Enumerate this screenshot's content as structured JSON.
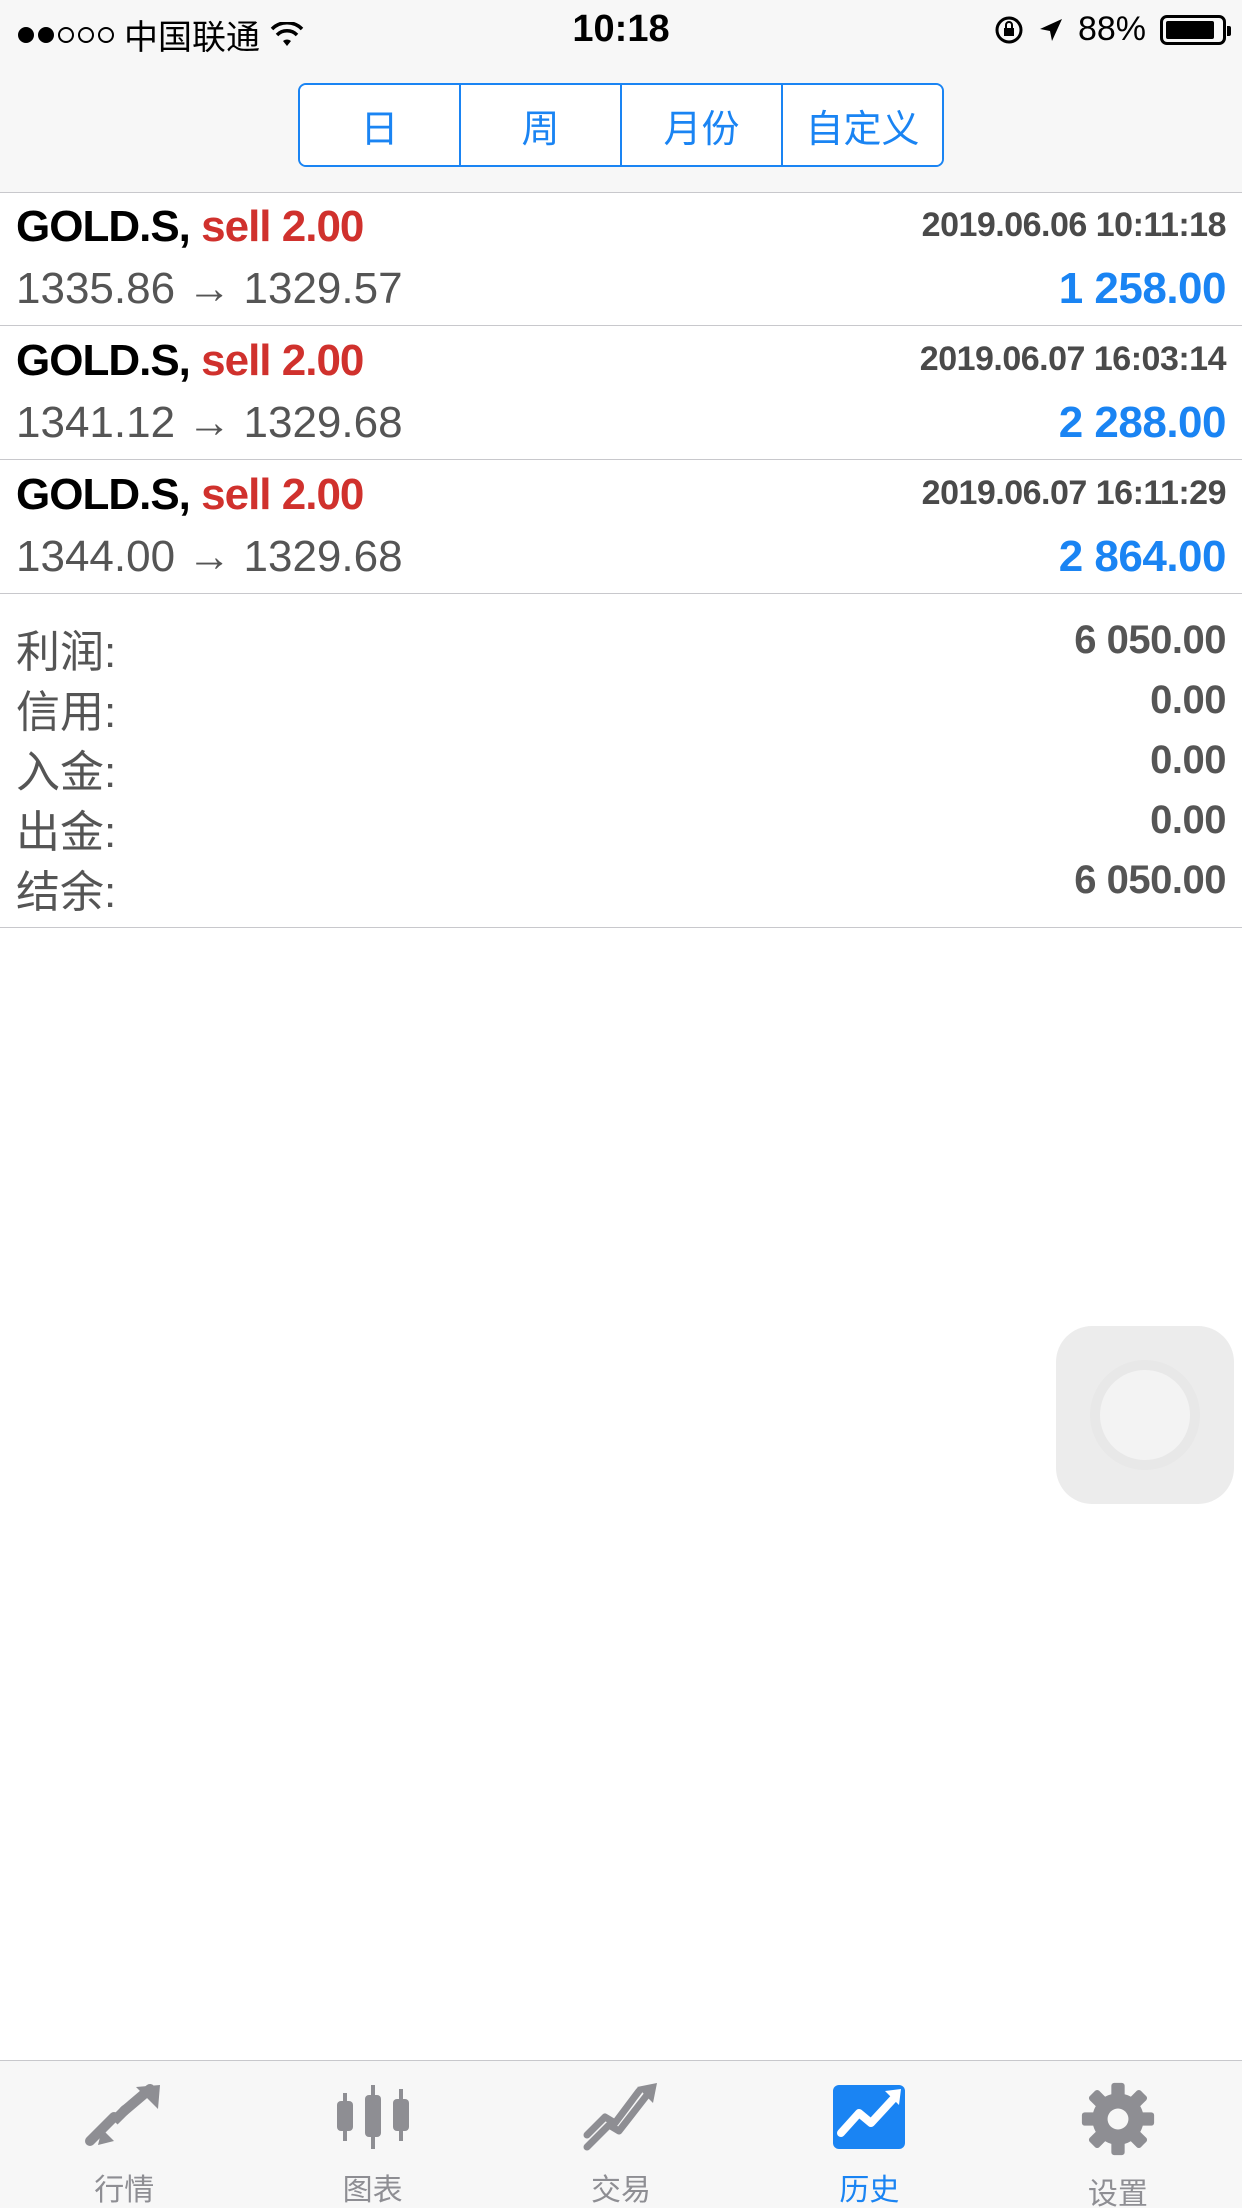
{
  "status_bar": {
    "carrier": "中国联通",
    "time": "10:18",
    "battery": "88%",
    "battery_level": 0.88
  },
  "period_tabs": [
    {
      "label": "日",
      "active": true
    },
    {
      "label": "周",
      "active": false
    },
    {
      "label": "月份",
      "active": false
    },
    {
      "label": "自定义",
      "active": false
    }
  ],
  "trades": [
    {
      "symbol": "GOLD.S,",
      "type": "sell 2.00",
      "time": "2019.06.06 10:11:18",
      "prices": "1335.86 → 1329.57",
      "profit": "1 258.00"
    },
    {
      "symbol": "GOLD.S,",
      "type": "sell 2.00",
      "time": "2019.06.07 16:03:14",
      "prices": "1341.12 → 1329.68",
      "profit": "2 288.00"
    },
    {
      "symbol": "GOLD.S,",
      "type": "sell 2.00",
      "time": "2019.06.07 16:11:29",
      "prices": "1344.00 → 1329.68",
      "profit": "2 864.00"
    }
  ],
  "summary": [
    {
      "label": "利润:",
      "value": "6 050.00"
    },
    {
      "label": "信用:",
      "value": "0.00"
    },
    {
      "label": "入金:",
      "value": "0.00"
    },
    {
      "label": "出金:",
      "value": "0.00"
    },
    {
      "label": "结余:",
      "value": "6 050.00"
    }
  ],
  "tab_bar": [
    {
      "label": "行情",
      "icon": "quotes-icon",
      "active": false
    },
    {
      "label": "图表",
      "icon": "chart-icon",
      "active": false
    },
    {
      "label": "交易",
      "icon": "trade-icon",
      "active": false
    },
    {
      "label": "历史",
      "icon": "history-icon",
      "active": true
    },
    {
      "label": "设置",
      "icon": "settings-icon",
      "active": false
    }
  ],
  "colors": {
    "accent": "#1a84f3",
    "sell": "#d0312d",
    "inactive_icon": "#8e8e93"
  }
}
